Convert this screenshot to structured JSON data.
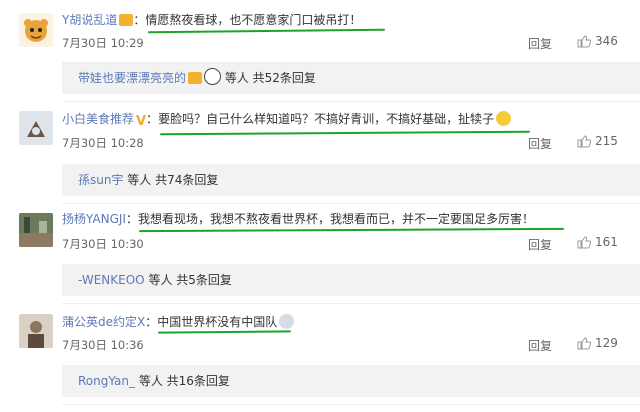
{
  "comments": [
    {
      "user": "Y胡说乱道",
      "text": "情愿熬夜看球，也不愿意家门口被吊打！",
      "date": "7月30日 10:29",
      "reply": "回复",
      "likes": "346",
      "sub_user": "带娃也要漂漂亮亮的",
      "sub_text": "等人 共52条回复"
    },
    {
      "user": "小白美食推荐",
      "text": "要脸吗？自己什么样知道吗？不搞好青训，不搞好基础，扯犊子",
      "date": "7月30日 10:28",
      "reply": "回复",
      "likes": "215",
      "sub_user": "孫sun宇",
      "sub_text": "等人 共74条回复"
    },
    {
      "user": "扬杨YANGJI",
      "text": "我想看现场，我想不熬夜看世界杯，我想看而已，并不一定要国足多厉害！",
      "date": "7月30日 10:30",
      "reply": "回复",
      "likes": "161",
      "sub_user": "-WENKEOO",
      "sub_text": "等人 共5条回复"
    },
    {
      "user": "蒲公英de约定X",
      "text": "中国世界杯没有中国队",
      "date": "7月30日 10:36",
      "reply": "回复",
      "likes": "129",
      "sub_user": "RongYan_",
      "sub_text": "等人 共16条回复"
    }
  ],
  "colors": {
    "username": "#5d79b6",
    "underline": "#1aa52a",
    "reply_bg": "#f2f2f2"
  },
  "icons": {
    "like": "thumbs-up-icon",
    "gift_badge": "gift-badge-icon",
    "verified": "verified-v-icon",
    "emoji": "emoji-icon"
  }
}
